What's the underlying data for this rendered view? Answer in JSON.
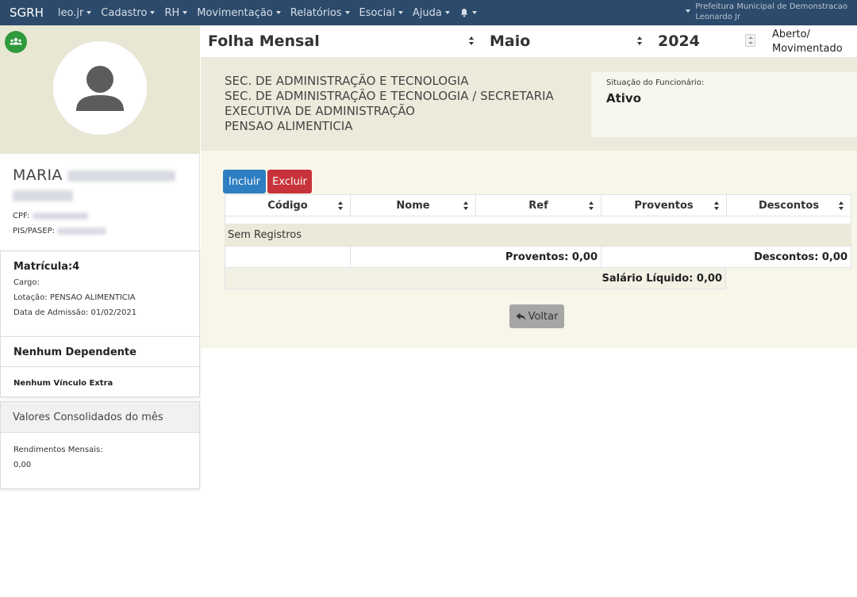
{
  "navbar": {
    "brand": "SGRH",
    "items": [
      {
        "label": "leo.jr"
      },
      {
        "label": "Cadastro"
      },
      {
        "label": "RH"
      },
      {
        "label": "Movimentação"
      },
      {
        "label": "Relatórios"
      },
      {
        "label": "Esocial"
      },
      {
        "label": "Ajuda"
      }
    ],
    "org": "Prefeitura Municipal de Demonstracao",
    "user": "Leonardo Jr"
  },
  "header": {
    "title": "Folha Mensal",
    "month": "Maio",
    "year": "2024",
    "status_line1": "Aberto/",
    "status_line2": "Movimentado"
  },
  "employee": {
    "first_name": "MARIA",
    "cpf_label": "CPF:",
    "pis_label": "PIS/PASEP:",
    "matricula": "Matrícula:4",
    "cargo_label": "Cargo:",
    "lotacao_label": "Lotação: PENSAO ALIMENTICIA",
    "admissao": "Data de Admissão: 01/02/2021",
    "dependentes": "Nenhum Dependente",
    "vinculo": "Nenhum Vínculo Extra",
    "consolidados_title": "Valores Consolidados do mês",
    "rendimentos_label": "Rendimentos Mensais:",
    "rendimentos_value": "0,00"
  },
  "lotacao": {
    "line1": "SEC. DE ADMINISTRAÇÃO E TECNOLOGIA",
    "line2": "SEC. DE ADMINISTRAÇÃO E TECNOLOGIA / SECRETARIA",
    "line3": "EXECUTIVA DE ADMINISTRAÇÃO",
    "line4": "PENSAO ALIMENTICIA"
  },
  "situacao": {
    "label": "Situação do Funcionário:",
    "value": "Ativo"
  },
  "actions": {
    "incluir": "Incluir",
    "excluir": "Excluir",
    "voltar": "Voltar"
  },
  "table": {
    "columns": [
      "Código",
      "Nome",
      "Ref",
      "Proventos",
      "Descontos"
    ],
    "empty_text": "Sem Registros",
    "proventos_total": "Proventos: 0,00",
    "descontos_total": "Descontos: 0,00",
    "salario_liquido": "Salário Líquido: 0,00"
  },
  "icons": {
    "group": "group-icon",
    "avatar": "user-avatar-icon",
    "bell": "bell-icon",
    "back": "reply-icon"
  },
  "colors": {
    "navbar": "#2c4a6b",
    "primary": "#2e7fc1",
    "danger": "#c8323a",
    "success": "#2e9a3c",
    "secondary": "#a6a6a6"
  }
}
